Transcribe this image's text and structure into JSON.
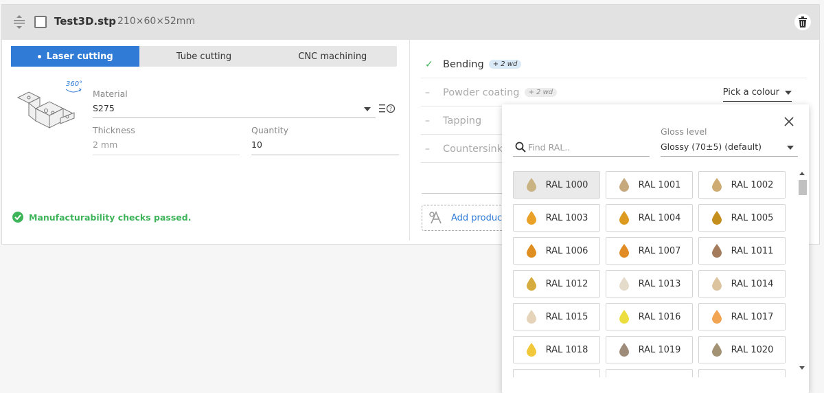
{
  "header": {
    "file_name": "Test3D.stp",
    "dimensions": "210×60×52mm"
  },
  "tabs": [
    {
      "label": "Laser cutting",
      "active": true
    },
    {
      "label": "Tube cutting",
      "active": false
    },
    {
      "label": "CNC machining",
      "active": false
    }
  ],
  "part": {
    "rotate_label": "360°",
    "material_label": "Material",
    "material_value": "S275",
    "thickness_label": "Thickness",
    "thickness_value": "2 mm",
    "quantity_label": "Quantity",
    "quantity_value": "10"
  },
  "status": {
    "message": "Manufacturability checks passed."
  },
  "processes": [
    {
      "name": "Bending",
      "badge": "+ 2 wd",
      "enabled": true
    },
    {
      "name": "Powder coating",
      "badge": "+ 2 wd",
      "enabled": false
    },
    {
      "name": "Tapping",
      "badge": "",
      "enabled": false
    },
    {
      "name": "Countersinking",
      "badge": "",
      "enabled": false
    }
  ],
  "pick_colour_label": "Pick a colour",
  "add_product_label": "Add product",
  "colour_popup": {
    "search_placeholder": "Find RAL..",
    "gloss_label": "Gloss level",
    "gloss_value": "Glossy (70±5) (default)",
    "swatches": [
      {
        "label": "RAL 1000",
        "color": "#c9b383"
      },
      {
        "label": "RAL 1001",
        "color": "#c7a97e"
      },
      {
        "label": "RAL 1002",
        "color": "#cdab72"
      },
      {
        "label": "RAL 1003",
        "color": "#eaa128"
      },
      {
        "label": "RAL 1004",
        "color": "#dc9a20"
      },
      {
        "label": "RAL 1005",
        "color": "#c58f1e"
      },
      {
        "label": "RAL 1006",
        "color": "#df8e22"
      },
      {
        "label": "RAL 1007",
        "color": "#e18b24"
      },
      {
        "label": "RAL 1011",
        "color": "#a57d5c"
      },
      {
        "label": "RAL 1012",
        "color": "#d5ac3d"
      },
      {
        "label": "RAL 1013",
        "color": "#e5dbcb"
      },
      {
        "label": "RAL 1014",
        "color": "#dcc49f"
      },
      {
        "label": "RAL 1015",
        "color": "#e5d4b9"
      },
      {
        "label": "RAL 1016",
        "color": "#ecde40"
      },
      {
        "label": "RAL 1017",
        "color": "#f1a452"
      },
      {
        "label": "RAL 1018",
        "color": "#f1c83a"
      },
      {
        "label": "RAL 1019",
        "color": "#9f8b7a"
      },
      {
        "label": "RAL 1020",
        "color": "#a39374"
      }
    ]
  },
  "colors": {
    "accent": "#2f7bd6",
    "success": "#3db35a"
  }
}
